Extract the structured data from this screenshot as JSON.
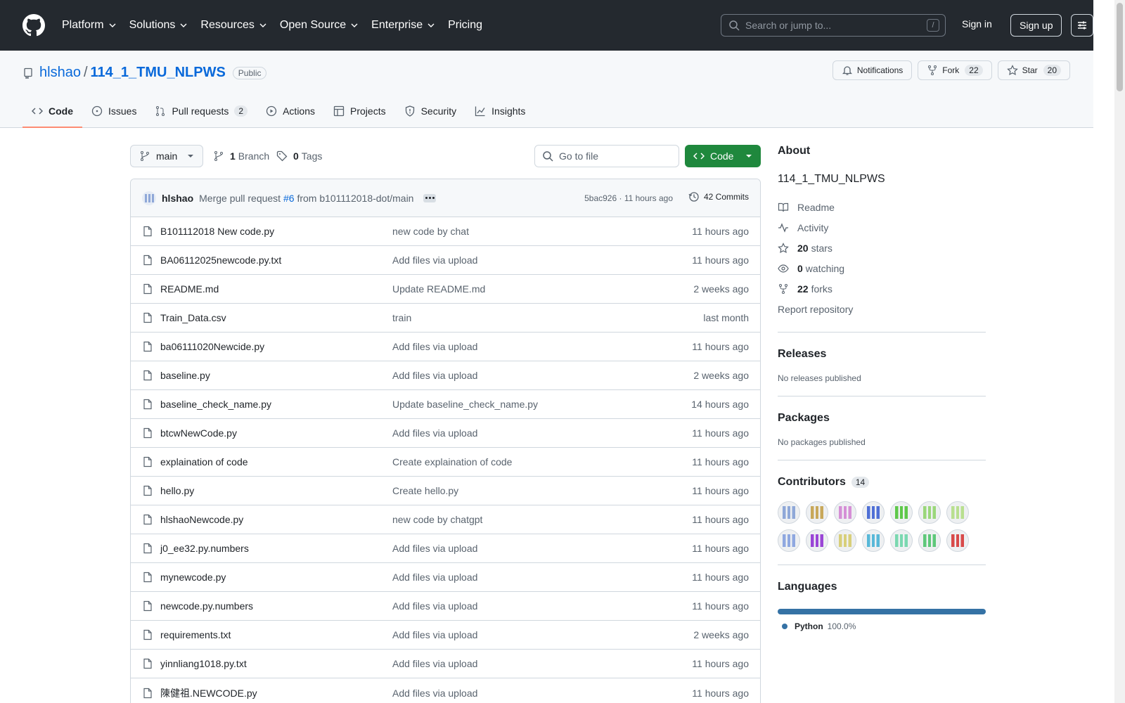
{
  "header": {
    "nav": [
      "Platform",
      "Solutions",
      "Resources",
      "Open Source",
      "Enterprise",
      "Pricing"
    ],
    "search_placeholder": "Search or jump to...",
    "search_key": "/",
    "sign_in": "Sign in",
    "sign_up": "Sign up"
  },
  "repo": {
    "owner": "hlshao",
    "name": "114_1_TMU_NLPWS",
    "visibility": "Public",
    "notifications": "Notifications",
    "fork_label": "Fork",
    "fork_count": "22",
    "star_label": "Star",
    "star_count": "20",
    "tabs": [
      {
        "label": "Code",
        "icon": "code-icon"
      },
      {
        "label": "Issues",
        "icon": "issue-icon"
      },
      {
        "label": "Pull requests",
        "icon": "pull-request-icon",
        "count": "2"
      },
      {
        "label": "Actions",
        "icon": "play-icon"
      },
      {
        "label": "Projects",
        "icon": "table-icon"
      },
      {
        "label": "Security",
        "icon": "shield-icon"
      },
      {
        "label": "Insights",
        "icon": "graph-icon"
      }
    ]
  },
  "toolbar": {
    "branch": "main",
    "branch_count": "1",
    "branch_label": "Branch",
    "tag_count": "0",
    "tag_label": "Tags",
    "goto_placeholder": "Go to file",
    "code_button": "Code"
  },
  "commit": {
    "author": "hlshao",
    "message_prefix": "Merge pull request",
    "pr_link": "#6",
    "message_suffix": "from b101112018-dot/main",
    "sha": "5bac926",
    "time": "11 hours ago",
    "commits_label": "42 Commits"
  },
  "files": [
    {
      "name": "B101112018 New code.py",
      "message": "new code by chat",
      "time": "11 hours ago"
    },
    {
      "name": "BA06112025newcode.py.txt",
      "message": "Add files via upload",
      "time": "11 hours ago"
    },
    {
      "name": "README.md",
      "message": "Update README.md",
      "time": "2 weeks ago"
    },
    {
      "name": "Train_Data.csv",
      "message": "train",
      "time": "last month"
    },
    {
      "name": "ba06111020Newcide.py",
      "message": "Add files via upload",
      "time": "11 hours ago"
    },
    {
      "name": "baseline.py",
      "message": "Add files via upload",
      "time": "2 weeks ago"
    },
    {
      "name": "baseline_check_name.py",
      "message": "Update baseline_check_name.py",
      "time": "14 hours ago"
    },
    {
      "name": "btcwNewCode.py",
      "message": "Add files via upload",
      "time": "11 hours ago"
    },
    {
      "name": "explaination of code",
      "message": "Create explaination of code",
      "time": "11 hours ago"
    },
    {
      "name": "hello.py",
      "message": "Create hello.py",
      "time": "11 hours ago"
    },
    {
      "name": "hlshaoNewcode.py",
      "message": "new code by chatgpt",
      "time": "11 hours ago"
    },
    {
      "name": "j0_ee32.py.numbers",
      "message": "Add files via upload",
      "time": "11 hours ago"
    },
    {
      "name": "mynewcode.py",
      "message": "Add files via upload",
      "time": "11 hours ago"
    },
    {
      "name": "newcode.py.numbers",
      "message": "Add files via upload",
      "time": "11 hours ago"
    },
    {
      "name": "requirements.txt",
      "message": "Add files via upload",
      "time": "2 weeks ago"
    },
    {
      "name": "yinnliang1018.py.txt",
      "message": "Add files via upload",
      "time": "11 hours ago"
    },
    {
      "name": "陳健祖.NEWCODE.py",
      "message": "Add files via upload",
      "time": "11 hours ago"
    }
  ],
  "about": {
    "title": "About",
    "description": "114_1_TMU_NLPWS",
    "readme": "Readme",
    "activity": "Activity",
    "stars_count": "20",
    "stars_label": "stars",
    "watching_count": "0",
    "watching_label": "watching",
    "forks_count": "22",
    "forks_label": "forks",
    "report": "Report repository"
  },
  "releases": {
    "title": "Releases",
    "empty": "No releases published"
  },
  "packages": {
    "title": "Packages",
    "empty": "No packages published"
  },
  "contributors": {
    "title": "Contributors",
    "count": "14",
    "colors": [
      "#8fa8d8",
      "#c8a85a",
      "#d58fd6",
      "#4f6fd6",
      "#5ec84a",
      "#9ad77a",
      "#b8df8f",
      "#8fa8e0",
      "#9a45d6",
      "#d8cf7a",
      "#58b8d8",
      "#7ad8b0",
      "#5ec87a",
      "#d84a4a"
    ]
  },
  "languages": {
    "title": "Languages",
    "items": [
      {
        "name": "Python",
        "percent": "100.0%",
        "color": "#3572a5"
      }
    ]
  }
}
